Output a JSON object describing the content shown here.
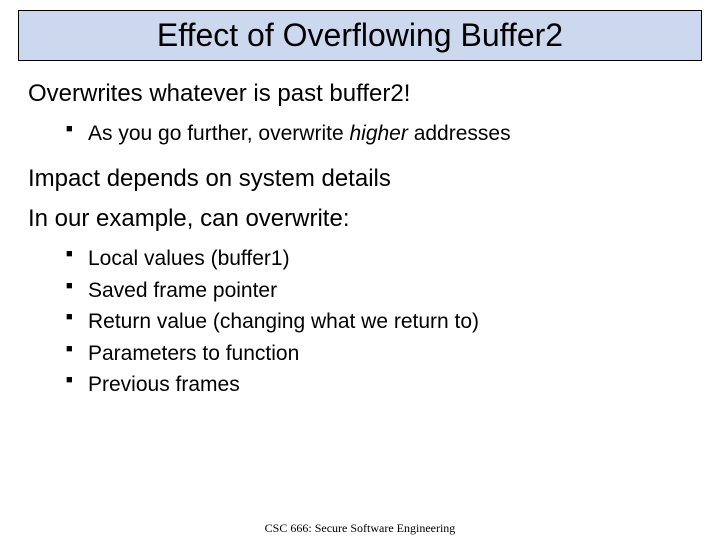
{
  "title": "Effect of Overflowing Buffer2",
  "point1": "Overwrites whatever is past buffer2!",
  "sub1": {
    "prefix": "As you go further, overwrite ",
    "italic": "higher",
    "suffix": " addresses"
  },
  "point2": "Impact depends on system details",
  "point3": "In our example, can overwrite:",
  "list2": [
    "Local values (buffer1)",
    "Saved frame pointer",
    "Return value (changing what we return to)",
    "Parameters to function",
    "Previous frames"
  ],
  "footer": "CSC 666: Secure Software Engineering"
}
